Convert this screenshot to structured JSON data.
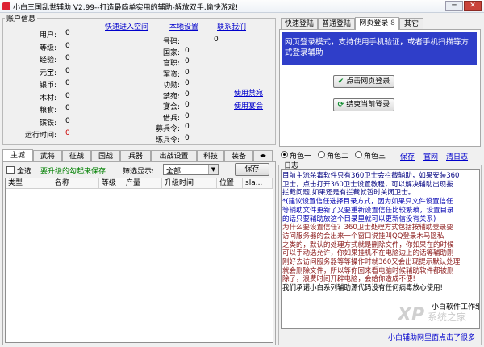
{
  "window": {
    "title": "小白三国乱世辅助 V2.99--打造最简单实用的辅助-解放双手,偷快游戏!",
    "min_label": "─",
    "close_label": "✕"
  },
  "account": {
    "group_title": "账户信息",
    "links": {
      "quick_enter": "快速进入空间",
      "local_settings": "本地设置",
      "contact_us": "联系我们"
    },
    "left_fields": [
      {
        "label": "用户:",
        "value": "0"
      },
      {
        "label": "等级:",
        "value": "0"
      },
      {
        "label": "经验:",
        "value": "0"
      },
      {
        "label": "元宝:",
        "value": "0"
      },
      {
        "label": "银币:",
        "value": "0"
      },
      {
        "label": "木材:",
        "value": "0"
      },
      {
        "label": "粮食:",
        "value": "0"
      },
      {
        "label": "镔铁:",
        "value": "0"
      },
      {
        "label": "运行时间:",
        "value": "0"
      }
    ],
    "right_fields": [
      {
        "label": "号码:",
        "value": "0"
      },
      {
        "label": "国家:",
        "value": "0"
      },
      {
        "label": "官职:",
        "value": "0"
      },
      {
        "label": "军资:",
        "value": "0"
      },
      {
        "label": "功勋:",
        "value": "0"
      },
      {
        "label": "禁宛:",
        "value": "0"
      },
      {
        "label": "宴会:",
        "value": "0"
      },
      {
        "label": "借兵:",
        "value": "0"
      },
      {
        "label": "募兵令:",
        "value": "0"
      },
      {
        "label": "练兵令:",
        "value": "0"
      }
    ],
    "use_jinyuan": "使用禁宛",
    "use_yanhui": "使用宴会"
  },
  "login": {
    "tabs": [
      "快速登陆",
      "普通登陆",
      "网页登录",
      "其它"
    ],
    "tab_close": "8",
    "info": "网页登录模式，支持使用手机验证，或者手机扫描等方式登录辅助",
    "login_button": "点击网页登录",
    "end_button": "结束当前登录"
  },
  "main_tabs": [
    "主城",
    "武将",
    "征战",
    "国战",
    "兵器",
    "出战设置",
    "科技",
    "装备"
  ],
  "filter": {
    "select_all": "全选",
    "hint": "要升级的勾起来保存",
    "show_label": "筛选显示:",
    "select_value": "全部",
    "save_button": "保存"
  },
  "table": {
    "columns": [
      "类型",
      "名称",
      "等级",
      "产量",
      "升级时间",
      "位置",
      "sla..."
    ],
    "rows": []
  },
  "roles": {
    "options": [
      "角色一",
      "角色二",
      "角色三"
    ],
    "selected": 0,
    "save": "保存",
    "official": "官网",
    "clear_log": "清日志"
  },
  "log": {
    "title": "日志",
    "lines": [
      {
        "text": "目前主流杀毒软件只有360卫士会拦截辅助，如果安装360",
        "color": "#000080",
        "link": false
      },
      {
        "text": "卫士，点击打开360卫士设置教程，可以解决辅助出现拔",
        "color": "#000080",
        "link": true
      },
      {
        "text": "拦截问题,如果还是有拦截就暂时关闭卫士。",
        "color": "#000080",
        "link": false
      },
      {
        "text": "*(建议设置信任选择目录方式，因为如果只文件设置信任",
        "color": "#0000b0",
        "link": false
      },
      {
        "text": "等辅助文件更新了又要重新设置信任比较繁琐，设置目录",
        "color": "#0000b0",
        "link": false
      },
      {
        "text": "的话只要辅助放这个目录里就可以更新信没有关系)",
        "color": "#0000b0",
        "link": false
      },
      {
        "text": "为什么要设置信任？360卫士处理方式包括按辅助登录要",
        "color": "#8b1a1a",
        "link": false
      },
      {
        "text": "访问服务器的会出来一个窗口说挂叫QQ登录木马隐私",
        "color": "#8b1a1a",
        "link": false
      },
      {
        "text": "之类的，默认的处理方式就是删除文件，你如果在的时候",
        "color": "#8b1a1a",
        "link": false
      },
      {
        "text": "可以手动选允许，你如果挂机不在电脑边上的话等辅助刚",
        "color": "#8b1a1a",
        "link": false
      },
      {
        "text": "刚好去访问服务器等等操作时就360又会出现提示默认处理",
        "color": "#8b1a1a",
        "link": false
      },
      {
        "text": "就会删除文件，所以等你回来看电脑时候辅助软件都被删",
        "color": "#8b1a1a",
        "link": false
      },
      {
        "text": "除了，浪费时间开辟电脑，会给你造成不便!",
        "color": "#8b1a1a",
        "link": false
      },
      {
        "text": "我们承诺小白系列辅助源代码没有任何病毒放心使用!",
        "color": "#000000",
        "link": false
      }
    ],
    "signature": "小白软件工作组"
  },
  "footer_link": "小白辅助网里面点击了很多",
  "watermark": {
    "brand": "XP",
    "text": "系统之家"
  },
  "colors": {
    "link": "#0000cc",
    "hint": "#008000",
    "info_bg": "#2f3ec9",
    "info_text": "#ffffff"
  }
}
